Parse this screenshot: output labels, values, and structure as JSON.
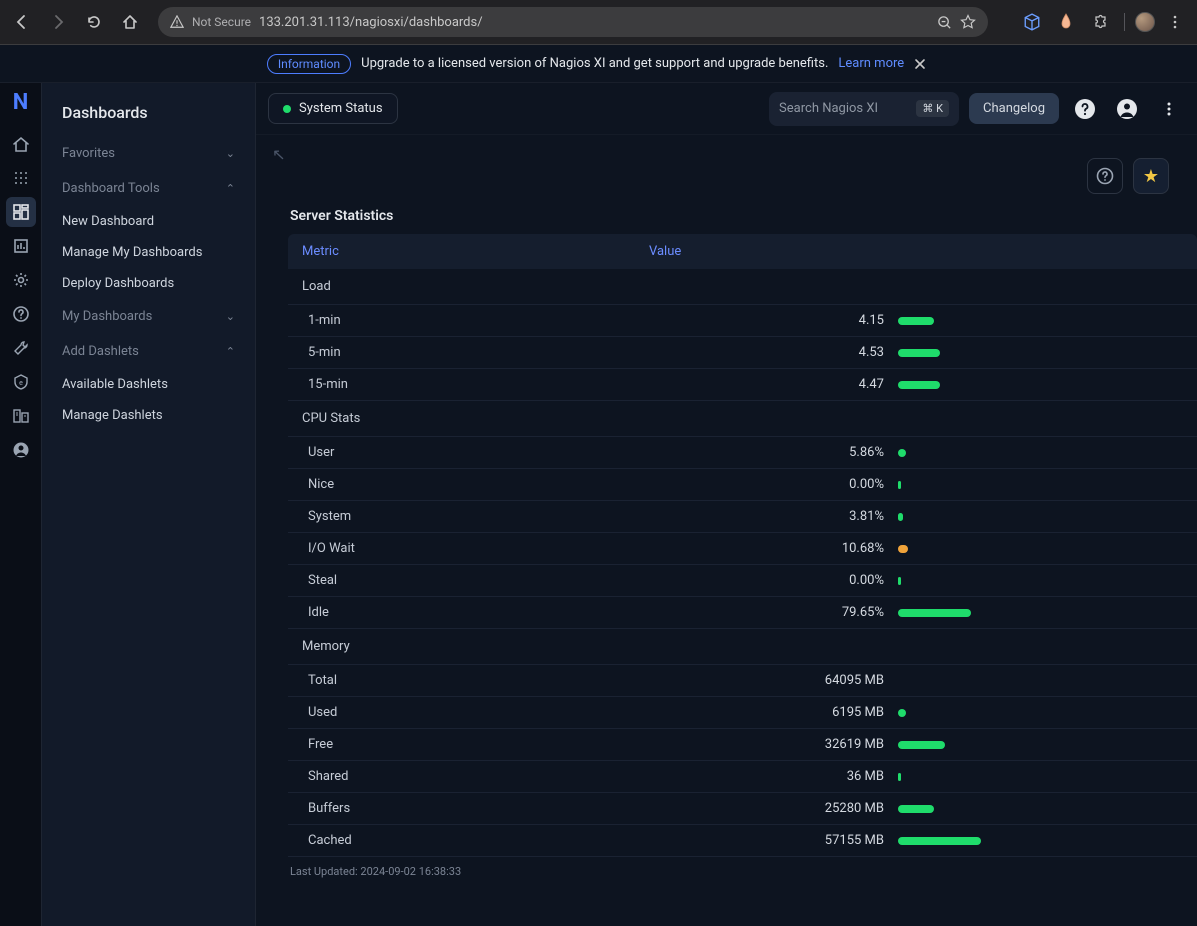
{
  "browser": {
    "url_prefix": "Not Secure",
    "url_obscured": "133.201.31.113",
    "url_path": "/nagiosxi/dashboards/"
  },
  "banner": {
    "tag": "Information",
    "text": "Upgrade to a licensed version of Nagios XI and get support and upgrade benefits.",
    "link": "Learn more"
  },
  "sidebar": {
    "title": "Dashboards",
    "groups": [
      {
        "label": "Favorites",
        "open": false,
        "items": []
      },
      {
        "label": "Dashboard Tools",
        "open": true,
        "items": [
          "New Dashboard",
          "Manage My Dashboards",
          "Deploy Dashboards"
        ]
      },
      {
        "label": "My Dashboards",
        "open": false,
        "items": []
      },
      {
        "label": "Add Dashlets",
        "open": true,
        "items": [
          "Available Dashlets",
          "Manage Dashlets"
        ]
      }
    ]
  },
  "topbar": {
    "active_tab": "System Status",
    "search_placeholder": "Search Nagios XI",
    "search_kbd": "⌘ K",
    "changelog": "Changelog"
  },
  "dashlet": {
    "title": "Server Statistics",
    "columns": {
      "metric": "Metric",
      "value": "Value"
    },
    "sections": [
      {
        "name": "Load",
        "rows": [
          {
            "label": "1-min",
            "value": "4.15",
            "bar_pct": 14,
            "color": "green"
          },
          {
            "label": "5-min",
            "value": "4.53",
            "bar_pct": 16,
            "color": "green"
          },
          {
            "label": "15-min",
            "value": "4.47",
            "bar_pct": 16,
            "color": "green"
          }
        ]
      },
      {
        "name": "CPU Stats",
        "rows": [
          {
            "label": "User",
            "value": "5.86%",
            "bar_pct": 3,
            "color": "green"
          },
          {
            "label": "Nice",
            "value": "0.00%",
            "bar_pct": 1,
            "color": "green"
          },
          {
            "label": "System",
            "value": "3.81%",
            "bar_pct": 2,
            "color": "green"
          },
          {
            "label": "I/O Wait",
            "value": "10.68%",
            "bar_pct": 4,
            "color": "orange"
          },
          {
            "label": "Steal",
            "value": "0.00%",
            "bar_pct": 1,
            "color": "green"
          },
          {
            "label": "Idle",
            "value": "79.65%",
            "bar_pct": 28,
            "color": "green"
          }
        ]
      },
      {
        "name": "Memory",
        "rows": [
          {
            "label": "Total",
            "value": "64095 MB",
            "bar_pct": null
          },
          {
            "label": "Used",
            "value": "6195 MB",
            "bar_pct": 3,
            "color": "green"
          },
          {
            "label": "Free",
            "value": "32619 MB",
            "bar_pct": 18,
            "color": "green"
          },
          {
            "label": "Shared",
            "value": "36 MB",
            "bar_pct": 1,
            "color": "green"
          },
          {
            "label": "Buffers",
            "value": "25280 MB",
            "bar_pct": 14,
            "color": "green"
          },
          {
            "label": "Cached",
            "value": "57155 MB",
            "bar_pct": 32,
            "color": "green"
          }
        ]
      }
    ],
    "last_updated": "Last Updated: 2024-09-02 16:38:33"
  },
  "chart_data": [
    {
      "type": "bar",
      "title": "Load",
      "categories": [
        "1-min",
        "5-min",
        "15-min"
      ],
      "values": [
        4.15,
        4.53,
        4.47
      ]
    },
    {
      "type": "bar",
      "title": "CPU Stats",
      "categories": [
        "User",
        "Nice",
        "System",
        "I/O Wait",
        "Steal",
        "Idle"
      ],
      "values": [
        5.86,
        0.0,
        3.81,
        10.68,
        0.0,
        79.65
      ],
      "unit": "%",
      "ylim": [
        0,
        100
      ]
    },
    {
      "type": "bar",
      "title": "Memory",
      "categories": [
        "Total",
        "Used",
        "Free",
        "Shared",
        "Buffers",
        "Cached"
      ],
      "values": [
        64095,
        6195,
        32619,
        36,
        25280,
        57155
      ],
      "unit": "MB"
    }
  ]
}
